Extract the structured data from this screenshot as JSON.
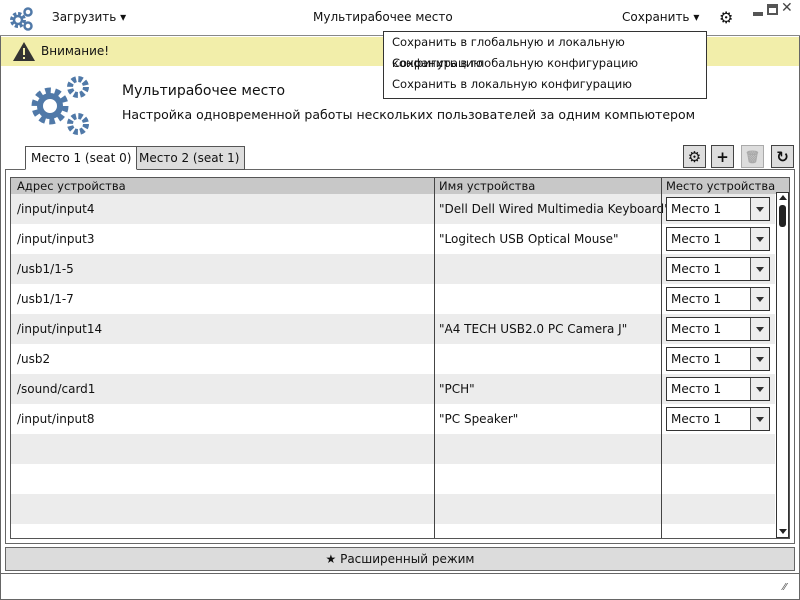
{
  "titlebar": {
    "load_label": "Загрузить",
    "title": "Мультирабочее место",
    "save_label": "Сохранить"
  },
  "save_menu": [
    "Сохранить в глобальную и локальную конфигурацию",
    "Сохранить в глобальную конфигурацию",
    "Сохранить в локальную конфигурацию"
  ],
  "warning": {
    "text": "Внимание!"
  },
  "hero": {
    "title": "Мультирабочее место",
    "subtitle": "Настройка одновременной работы нескольких пользователей за одним компьютером"
  },
  "tabs": [
    {
      "label": "Место 1 (seat 0)",
      "active": true
    },
    {
      "label": "Место 2 (seat 1)",
      "active": false
    }
  ],
  "table": {
    "headers": [
      "Адрес устройства",
      "Имя устройства",
      "Место устройства"
    ],
    "rows": [
      {
        "address": "/input/input4",
        "name": "\"Dell Dell Wired Multimedia Keyboard\"",
        "seat": "Место 1"
      },
      {
        "address": "/input/input3",
        "name": "\"Logitech USB Optical Mouse\"",
        "seat": "Место 1"
      },
      {
        "address": "/usb1/1-5",
        "name": "",
        "seat": "Место 1"
      },
      {
        "address": "/usb1/1-7",
        "name": "",
        "seat": "Место 1"
      },
      {
        "address": "/input/input14",
        "name": "\"A4 TECH USB2.0 PC Camera J\"",
        "seat": "Место 1"
      },
      {
        "address": "/usb2",
        "name": "",
        "seat": "Место 1"
      },
      {
        "address": "/sound/card1",
        "name": "\"PCH\"",
        "seat": "Место 1"
      },
      {
        "address": "/input/input8",
        "name": "\"PC Speaker\"",
        "seat": "Место 1"
      }
    ]
  },
  "advanced_label": "Расширенный режим",
  "colors": {
    "accent": "#5079a8",
    "warning_bg": "#f2eeaa"
  }
}
